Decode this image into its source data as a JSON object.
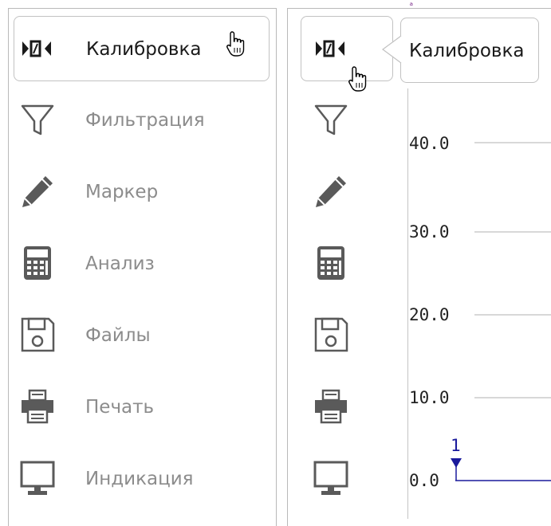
{
  "menu": {
    "items": [
      {
        "label": "Калибровка",
        "icon": "calibration-icon",
        "active": true
      },
      {
        "label": "Фильтрация",
        "icon": "filter-icon",
        "active": false
      },
      {
        "label": "Маркер",
        "icon": "pencil-icon",
        "active": false
      },
      {
        "label": "Анализ",
        "icon": "calculator-icon",
        "active": false
      },
      {
        "label": "Файлы",
        "icon": "floppy-disk-icon",
        "active": false
      },
      {
        "label": "Печать",
        "icon": "printer-icon",
        "active": false
      },
      {
        "label": "Индикация",
        "icon": "monitor-icon",
        "active": false
      }
    ]
  },
  "tooltip": {
    "text": "Калибровка"
  },
  "chart": {
    "y_ticks": [
      "40.0",
      "30.0",
      "20.0",
      "10.0",
      "0.0"
    ],
    "marker_label": "1",
    "header_fragment": "ᵃ"
  },
  "colors": {
    "icon": "#5a5a5a",
    "label": "#8c8c8c",
    "trace": "#1a1a9c",
    "grid": "#b0b0b0"
  }
}
